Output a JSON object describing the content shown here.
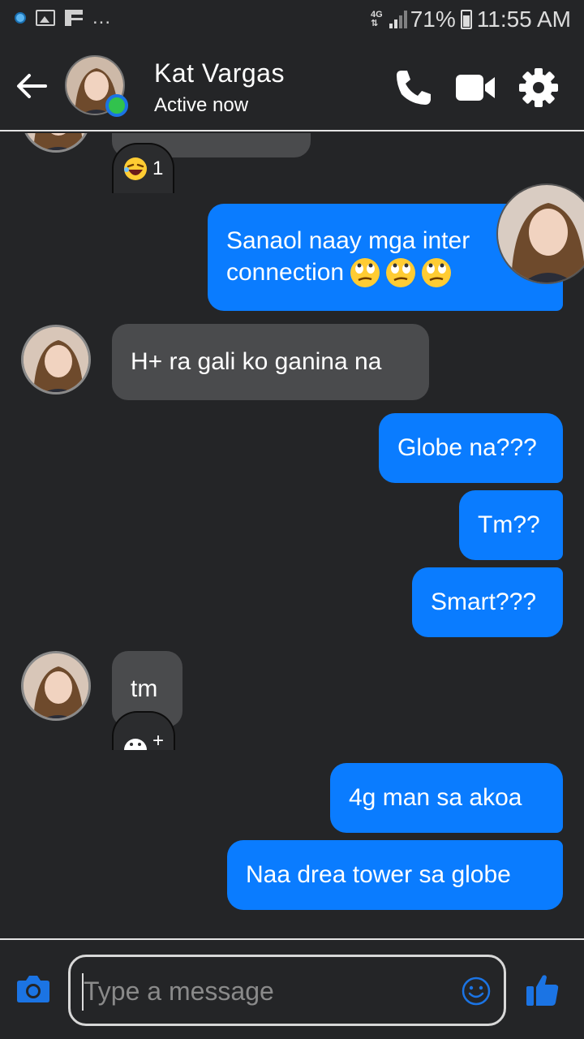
{
  "status_bar": {
    "network": "4G",
    "battery": "71%",
    "time": "11:55 AM",
    "overflow": "..."
  },
  "header": {
    "contact_name": "Kat Vargas",
    "presence": "Active now",
    "icons": [
      "back-arrow-icon",
      "phone-icon",
      "video-camera-icon",
      "gear-icon"
    ]
  },
  "messages": [
    {
      "from": "them",
      "partial": true,
      "reaction": {
        "icon": "laughing-emoji",
        "count": "1"
      }
    },
    {
      "from": "me",
      "lines": [
        "Sanaol naay mga inter",
        "connection"
      ],
      "emojis": [
        "rolling-eyes-emoji",
        "rolling-eyes-emoji",
        "rolling-eyes-emoji"
      ]
    },
    {
      "from": "them",
      "text": "H+ ra gali ko ganina na"
    },
    {
      "from": "me",
      "text": "Globe na???"
    },
    {
      "from": "me",
      "text": "Tm??"
    },
    {
      "from": "me",
      "text": "Smart???"
    },
    {
      "from": "them",
      "text": "tm",
      "reaction": {
        "icon": "emoji-face",
        "count": "+"
      }
    },
    {
      "from": "me",
      "text": "4g man sa akoa"
    },
    {
      "from": "me",
      "text": "Naa drea tower sa globe"
    }
  ],
  "composer": {
    "placeholder": "Type a message",
    "icons": [
      "camera-icon",
      "smiley-icon",
      "thumbs-up-icon"
    ]
  },
  "colors": {
    "background": "#242527",
    "incoming_bubble": "#4a4b4d",
    "outgoing_bubble": "#0a7cff",
    "accent": "#1b74e4",
    "online": "#31c24d"
  }
}
